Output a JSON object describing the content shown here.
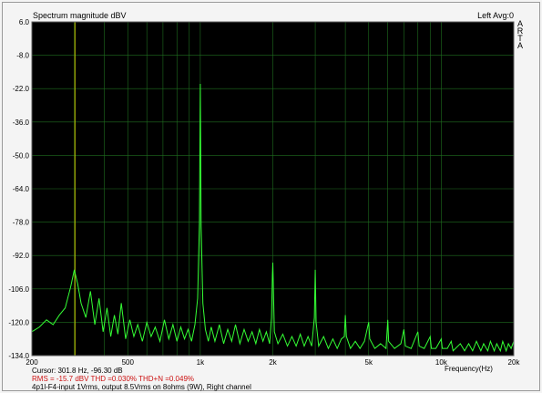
{
  "window": {
    "title_left": "Spectrum magnitude dBV",
    "title_right": "Left  Avg:0",
    "arta_letters": [
      "A",
      "R",
      "T",
      "A"
    ]
  },
  "colors": {
    "background": "#000000",
    "grid": "#1f6e1f",
    "trace": "#34ff34",
    "cursor": "#c8c800"
  },
  "footer": {
    "cursor_text": "Cursor:   301.8 Hz, -96.30 dB",
    "rms_text": "RMS =  -15.7 dBV   THD =0.030%   THD+N =0.049%",
    "description": "4p1l-F4-input 1Vrms, output 8.5Vrms on 8ohms (9W), Right channel"
  },
  "chart_data": {
    "type": "line",
    "title": "Spectrum magnitude dBV",
    "xlabel": "Frequency(Hz)",
    "ylabel": "",
    "x_scale": "log",
    "xlim": [
      200,
      20000
    ],
    "ylim": [
      -134,
      6
    ],
    "grid": true,
    "x_ticks": [
      {
        "value": 200,
        "label": "200"
      },
      {
        "value": 500,
        "label": "500"
      },
      {
        "value": 1000,
        "label": "1k"
      },
      {
        "value": 2000,
        "label": "2k"
      },
      {
        "value": 5000,
        "label": "5k"
      },
      {
        "value": 10000,
        "label": "10k"
      },
      {
        "value": 20000,
        "label": "20k"
      }
    ],
    "y_ticks": [
      {
        "value": 6,
        "label": "6.0"
      },
      {
        "value": -8,
        "label": "-8.0"
      },
      {
        "value": -22,
        "label": "-22.0"
      },
      {
        "value": -36,
        "label": "-36.0"
      },
      {
        "value": -50,
        "label": "-50.0"
      },
      {
        "value": -64,
        "label": "-64.0"
      },
      {
        "value": -78,
        "label": "-78.0"
      },
      {
        "value": -92,
        "label": "-92.0"
      },
      {
        "value": -106,
        "label": "-106.0"
      },
      {
        "value": -120,
        "label": "-120.0"
      },
      {
        "value": -134,
        "label": "-134.0"
      }
    ],
    "cursor_frequency": 301.8,
    "series": [
      {
        "points": [
          [
            200,
            -124
          ],
          [
            215,
            -122
          ],
          [
            230,
            -119
          ],
          [
            245,
            -121
          ],
          [
            260,
            -117
          ],
          [
            275,
            -114
          ],
          [
            290,
            -105
          ],
          [
            300,
            -98
          ],
          [
            310,
            -104
          ],
          [
            320,
            -112
          ],
          [
            335,
            -118
          ],
          [
            350,
            -107
          ],
          [
            365,
            -121
          ],
          [
            380,
            -110
          ],
          [
            395,
            -124
          ],
          [
            410,
            -114
          ],
          [
            425,
            -126
          ],
          [
            440,
            -117
          ],
          [
            455,
            -125
          ],
          [
            470,
            -112
          ],
          [
            490,
            -127
          ],
          [
            510,
            -119
          ],
          [
            530,
            -126
          ],
          [
            550,
            -121
          ],
          [
            575,
            -128
          ],
          [
            600,
            -120
          ],
          [
            625,
            -126
          ],
          [
            650,
            -122
          ],
          [
            680,
            -128
          ],
          [
            710,
            -119
          ],
          [
            740,
            -127
          ],
          [
            770,
            -121
          ],
          [
            800,
            -128
          ],
          [
            830,
            -122
          ],
          [
            860,
            -127
          ],
          [
            890,
            -123
          ],
          [
            920,
            -128
          ],
          [
            950,
            -121
          ],
          [
            975,
            -110
          ],
          [
            992,
            -78
          ],
          [
            1000,
            -20
          ],
          [
            1008,
            -80
          ],
          [
            1025,
            -112
          ],
          [
            1050,
            -123
          ],
          [
            1080,
            -128
          ],
          [
            1110,
            -122
          ],
          [
            1150,
            -128
          ],
          [
            1200,
            -121
          ],
          [
            1250,
            -129
          ],
          [
            1300,
            -123
          ],
          [
            1350,
            -128
          ],
          [
            1400,
            -121
          ],
          [
            1460,
            -129
          ],
          [
            1520,
            -123
          ],
          [
            1580,
            -128
          ],
          [
            1640,
            -124
          ],
          [
            1700,
            -129
          ],
          [
            1760,
            -123
          ],
          [
            1820,
            -128
          ],
          [
            1880,
            -124
          ],
          [
            1940,
            -129
          ],
          [
            1975,
            -118
          ],
          [
            1992,
            -100
          ],
          [
            2000,
            -95
          ],
          [
            2008,
            -103
          ],
          [
            2030,
            -124
          ],
          [
            2100,
            -129
          ],
          [
            2200,
            -125
          ],
          [
            2300,
            -130
          ],
          [
            2400,
            -126
          ],
          [
            2500,
            -130
          ],
          [
            2600,
            -125
          ],
          [
            2700,
            -130
          ],
          [
            2800,
            -126
          ],
          [
            2900,
            -130
          ],
          [
            2975,
            -118
          ],
          [
            3000,
            -98
          ],
          [
            3025,
            -120
          ],
          [
            3100,
            -130
          ],
          [
            3250,
            -126
          ],
          [
            3400,
            -131
          ],
          [
            3550,
            -127
          ],
          [
            3700,
            -131
          ],
          [
            3850,
            -127
          ],
          [
            3960,
            -126
          ],
          [
            4000,
            -117
          ],
          [
            4040,
            -126
          ],
          [
            4200,
            -131
          ],
          [
            4400,
            -128
          ],
          [
            4600,
            -131
          ],
          [
            4800,
            -128
          ],
          [
            5000,
            -120
          ],
          [
            5050,
            -127
          ],
          [
            5300,
            -131
          ],
          [
            5600,
            -129
          ],
          [
            5900,
            -131
          ],
          [
            6000,
            -119
          ],
          [
            6050,
            -128
          ],
          [
            6400,
            -131
          ],
          [
            6800,
            -129
          ],
          [
            7000,
            -123
          ],
          [
            7100,
            -130
          ],
          [
            7500,
            -131
          ],
          [
            8000,
            -124
          ],
          [
            8100,
            -130
          ],
          [
            8500,
            -131
          ],
          [
            9000,
            -126
          ],
          [
            9100,
            -131
          ],
          [
            9500,
            -131
          ],
          [
            10000,
            -127
          ],
          [
            10100,
            -131
          ],
          [
            10600,
            -131
          ],
          [
            11000,
            -128
          ],
          [
            11200,
            -132
          ],
          [
            12000,
            -129
          ],
          [
            12500,
            -132
          ],
          [
            13000,
            -129
          ],
          [
            13500,
            -132
          ],
          [
            14000,
            -128
          ],
          [
            14600,
            -132
          ],
          [
            15000,
            -129
          ],
          [
            15600,
            -132
          ],
          [
            16000,
            -128
          ],
          [
            16600,
            -132
          ],
          [
            17000,
            -129
          ],
          [
            17600,
            -132
          ],
          [
            18000,
            -128
          ],
          [
            18600,
            -132
          ],
          [
            19000,
            -129
          ],
          [
            19500,
            -131
          ],
          [
            20000,
            -128
          ]
        ]
      }
    ]
  }
}
